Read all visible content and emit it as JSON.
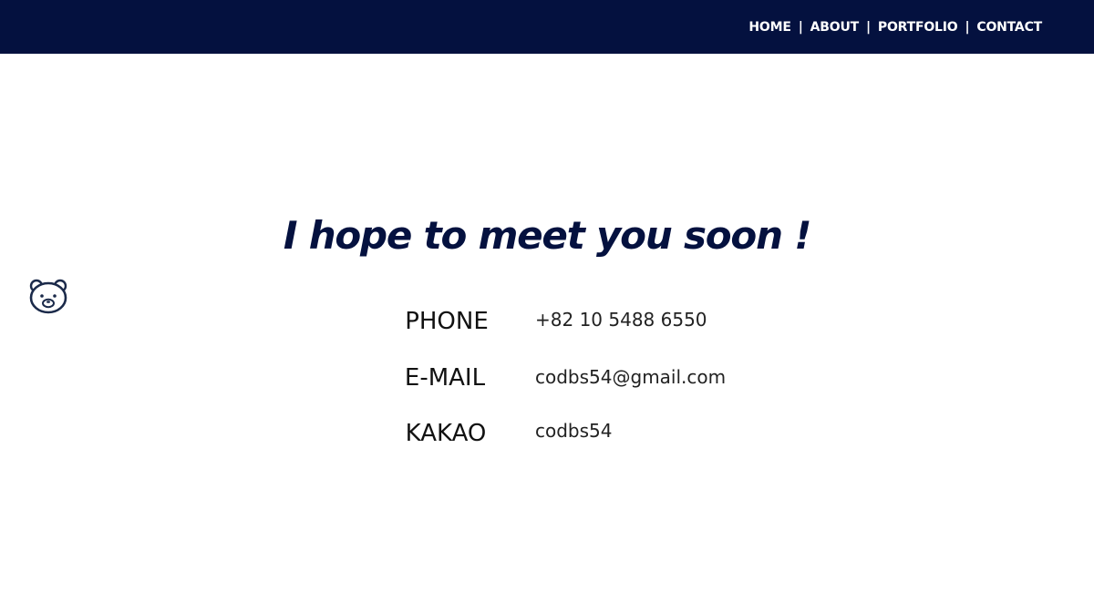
{
  "nav": {
    "items": [
      {
        "label": "HOME"
      },
      {
        "label": "ABOUT"
      },
      {
        "label": "PORTFOLIO"
      },
      {
        "label": "CONTACT"
      }
    ],
    "separator": "|"
  },
  "main": {
    "headline": "I hope to meet you soon !",
    "contacts": [
      {
        "label": "PHONE",
        "value": "+82 10 5488 6550"
      },
      {
        "label": "E-MAIL",
        "value": "codbs54@gmail.com"
      },
      {
        "label": "KAKAO",
        "value": "codbs54"
      }
    ]
  },
  "icons": {
    "floating": "bear-icon"
  },
  "colors": {
    "header_bg": "#04113f",
    "accent": "#04113f",
    "text": "#111111"
  }
}
